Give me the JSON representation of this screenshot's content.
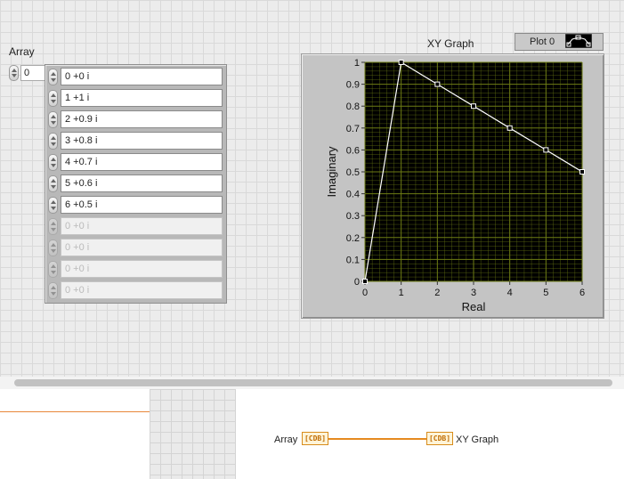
{
  "front_panel": {
    "array": {
      "label": "Array",
      "index_value": "0",
      "elements": [
        "0 +0 i",
        "1 +1 i",
        "2 +0.9 i",
        "3 +0.8 i",
        "4 +0.7 i",
        "5 +0.6 i",
        "6 +0.5 i"
      ],
      "ghost_elements": [
        "0 +0 i",
        "0 +0 i",
        "0 +0 i",
        "0 +0 i"
      ]
    },
    "graph": {
      "title": "XY Graph",
      "legend_label": "Plot 0"
    }
  },
  "chart_data": {
    "type": "line",
    "xlabel": "Real",
    "ylabel": "Imaginary",
    "xlim": [
      0,
      6
    ],
    "ylim": [
      0,
      1
    ],
    "x_ticks": [
      "0",
      "1",
      "2",
      "3",
      "4",
      "5",
      "6"
    ],
    "y_ticks": [
      "0",
      "0.1",
      "0.2",
      "0.3",
      "0.4",
      "0.5",
      "0.6",
      "0.7",
      "0.8",
      "0.9",
      "1"
    ],
    "grid": true,
    "series": [
      {
        "x": [
          0,
          1,
          2,
          3,
          4,
          5,
          6
        ],
        "y": [
          0,
          1,
          0.9,
          0.8,
          0.7,
          0.6,
          0.5
        ]
      }
    ],
    "colors": {
      "plot_bg": "#000000",
      "grid": "#6e7d14",
      "line": "#ffffff"
    }
  },
  "block_diagram": {
    "array_label": "Array",
    "array_terminal": "[CDB]",
    "graph_label": "XY Graph",
    "graph_terminal": "[CDB]"
  }
}
